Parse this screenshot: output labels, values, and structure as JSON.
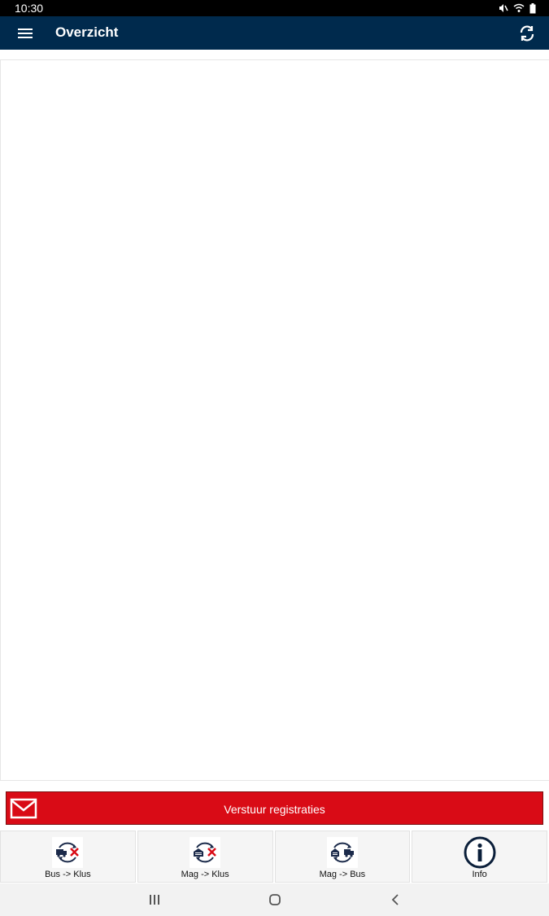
{
  "status_bar": {
    "time": "10:30",
    "icons": [
      "mute-icon",
      "wifi-icon",
      "battery-icon"
    ]
  },
  "app_bar": {
    "title": "Overzicht",
    "menu_icon": "menu-icon",
    "refresh_icon": "refresh-icon",
    "color": "#002a4d"
  },
  "actions": {
    "send_label": "Verstuur registraties",
    "send_icon": "mail-icon",
    "send_color": "#d90b16"
  },
  "tabs": [
    {
      "label": "Bus -> Klus",
      "icon": "bus-to-job-icon"
    },
    {
      "label": "Mag -> Klus",
      "icon": "warehouse-to-job-icon"
    },
    {
      "label": "Mag -> Bus",
      "icon": "warehouse-to-bus-icon"
    },
    {
      "label": "Info",
      "icon": "info-icon"
    }
  ],
  "nav_bar": {
    "icons": [
      "recent-apps-icon",
      "home-icon",
      "back-icon"
    ]
  }
}
